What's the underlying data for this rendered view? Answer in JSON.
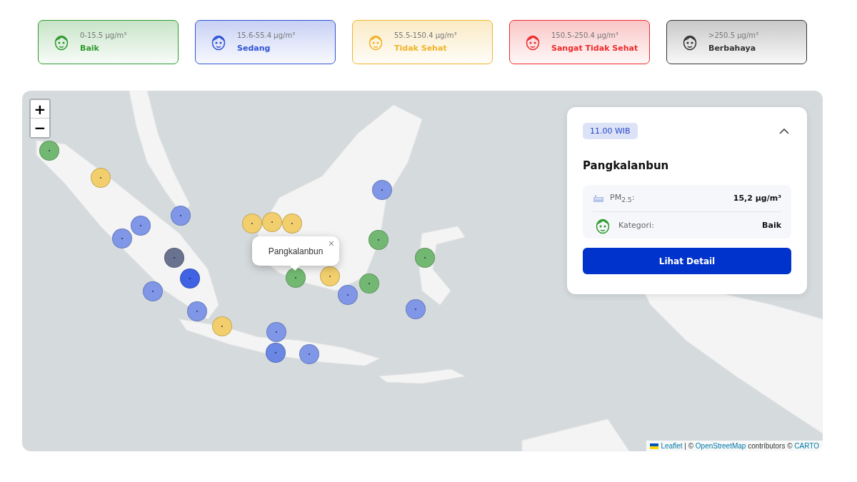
{
  "legend": [
    {
      "range": "0-15.5 µg/m³",
      "label": "Baik",
      "color": "#2e9a2e"
    },
    {
      "range": "15.6-55.4 µg/m³",
      "label": "Sedang",
      "color": "#2f52d6"
    },
    {
      "range": "55.5-150.4 µg/m³",
      "label": "Tidak Sehat",
      "color": "#f0b429"
    },
    {
      "range": "150.5-250.4 µg/m³",
      "label": "Sangat Tidak Sehat",
      "color": "#ee2a2a"
    },
    {
      "range": ">250.5 µg/m³",
      "label": "Berbahaya",
      "color": "#333333"
    }
  ],
  "map": {
    "zoom_controls": [
      "+",
      "−"
    ],
    "markers": [
      {
        "color": "#72b872"
      },
      {
        "color": "#f2cf6c"
      },
      {
        "color": "#7f97e6"
      },
      {
        "color": "#7f97e6"
      },
      {
        "color": "#7f97e6"
      },
      {
        "color": "#69728f"
      },
      {
        "color": "#3f63e2"
      },
      {
        "color": "#7f97e6"
      },
      {
        "color": "#7f97e6"
      },
      {
        "color": "#f2cf6c"
      },
      {
        "color": "#7f97e6"
      },
      {
        "color": "#6a87e4"
      },
      {
        "color": "#7f97e6"
      },
      {
        "color": "#f2cf6c"
      },
      {
        "color": "#f2cf6c"
      },
      {
        "color": "#f2cf6c"
      },
      {
        "color": "#72b872"
      },
      {
        "color": "#f2cf6c"
      },
      {
        "color": "#7f97e6"
      },
      {
        "color": "#72b872"
      },
      {
        "color": "#72b872"
      },
      {
        "color": "#7f97e6"
      },
      {
        "color": "#72b872"
      },
      {
        "color": "#7f97e6"
      }
    ],
    "popup": {
      "title": "Pangkalanbun",
      "close": "×"
    },
    "info_card": {
      "time": "11.00 WIB",
      "expanded": true,
      "station": "Pangkalanbun",
      "rows": [
        {
          "kind": "pm",
          "label": "PM$_{2.5}$:",
          "value": "15,2 µg/m³"
        },
        {
          "kind": "category",
          "label": "Kategori:",
          "value": "Baik"
        }
      ],
      "button": "Lihat Detail"
    },
    "attribution": [
      {
        "kind": "link",
        "text": "Leaflet"
      },
      {
        "kind": "text",
        "text": " | © "
      },
      {
        "kind": "link",
        "text": "OpenStreetMap"
      },
      {
        "kind": "text",
        "text": " contributors © "
      },
      {
        "kind": "link",
        "text": "CARTO"
      }
    ]
  }
}
